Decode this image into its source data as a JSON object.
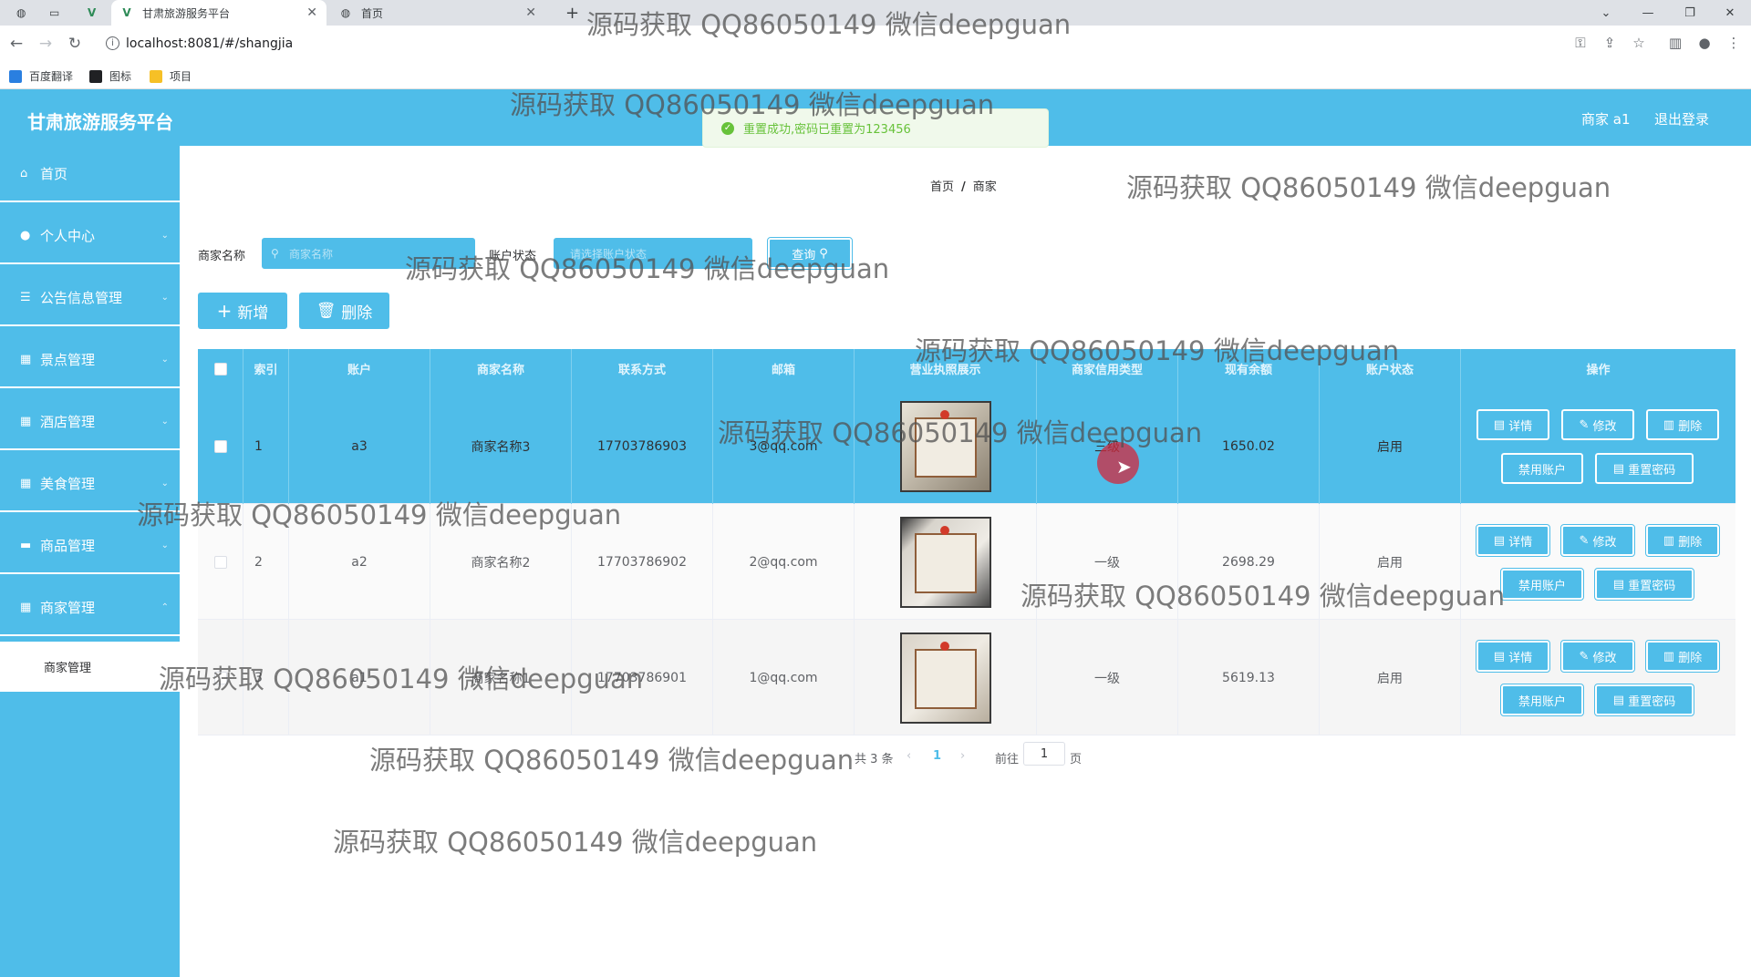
{
  "browser": {
    "tabs": [
      {
        "title": "甘肃旅游服务平台",
        "active": true
      },
      {
        "title": "首页",
        "active": false
      }
    ],
    "url": "localhost:8081/#/shangjia",
    "bookmarks": [
      "百度翻译",
      "图标",
      "项目"
    ]
  },
  "header": {
    "brand": "甘肃旅游服务平台",
    "user": "商家 a1",
    "logout": "退出登录"
  },
  "sidebar": {
    "items": [
      {
        "label": "首页",
        "icon": "home-icon"
      },
      {
        "label": "个人中心",
        "icon": "user-icon"
      },
      {
        "label": "公告信息管理",
        "icon": "list-icon"
      },
      {
        "label": "景点管理",
        "icon": "grid-icon"
      },
      {
        "label": "酒店管理",
        "icon": "grid-icon"
      },
      {
        "label": "美食管理",
        "icon": "grid-icon"
      },
      {
        "label": "商品管理",
        "icon": "chat-icon"
      },
      {
        "label": "商家管理",
        "icon": "grid-icon"
      }
    ],
    "submenu": "商家管理"
  },
  "breadcrumb": [
    "首页",
    "商家"
  ],
  "toast": "重置成功,密码已重置为123456",
  "search": {
    "name_label": "商家名称",
    "name_placeholder": "商家名称",
    "status_label": "账户状态",
    "status_placeholder": "请选择账户状态",
    "query": "查询"
  },
  "actions": {
    "add": "新增",
    "delete": "删除"
  },
  "table": {
    "columns": [
      "索引",
      "账户",
      "商家名称",
      "联系方式",
      "邮箱",
      "营业执照展示",
      "商家信用类型",
      "现有余额",
      "账户状态",
      "操作"
    ],
    "rows": [
      {
        "index": "1",
        "account": "a3",
        "name": "商家名称3",
        "phone": "17703786903",
        "email": "3@qq.com",
        "credit": "三级",
        "balance": "1650.02",
        "status": "启用"
      },
      {
        "index": "2",
        "account": "a2",
        "name": "商家名称2",
        "phone": "17703786902",
        "email": "2@qq.com",
        "credit": "一级",
        "balance": "2698.29",
        "status": "启用"
      },
      {
        "index": "3",
        "account": "a1",
        "name": "商家名称1",
        "phone": "17703786901",
        "email": "1@qq.com",
        "credit": "一级",
        "balance": "5619.13",
        "status": "启用"
      }
    ],
    "row_buttons": {
      "detail": "详情",
      "edit": "修改",
      "delete": "删除",
      "disable": "禁用账户",
      "reset": "重置密码"
    }
  },
  "pager": {
    "total": "共 3 条",
    "current": "1",
    "goto": "前往",
    "page_value": "1",
    "page_unit": "页"
  },
  "watermark": "源码获取 QQ86050149 微信deepguan",
  "colors": {
    "primary": "#4fbde9",
    "success": "#67c23a"
  }
}
